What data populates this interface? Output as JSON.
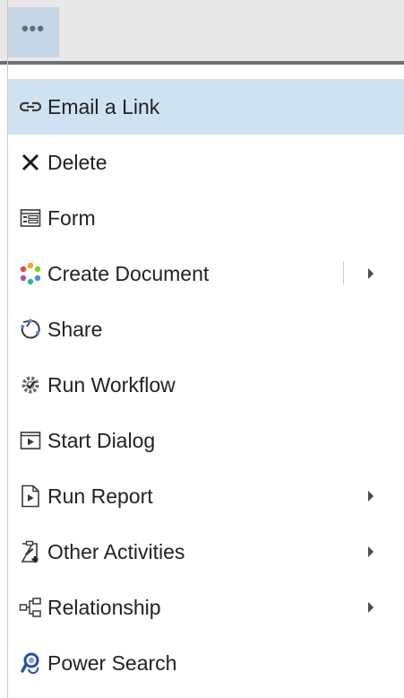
{
  "toolbar": {
    "more_label": "•••"
  },
  "menu": {
    "items": [
      {
        "label": "Email a Link",
        "icon": "link-icon"
      },
      {
        "label": "Delete",
        "icon": "delete-x-icon"
      },
      {
        "label": "Form",
        "icon": "form-icon"
      },
      {
        "label": "Create Document",
        "icon": "create-document-icon",
        "has_submenu": true
      },
      {
        "label": "Share",
        "icon": "share-icon"
      },
      {
        "label": "Run Workflow",
        "icon": "workflow-icon"
      },
      {
        "label": "Start Dialog",
        "icon": "start-dialog-icon"
      },
      {
        "label": "Run Report",
        "icon": "report-icon",
        "has_submenu": true
      },
      {
        "label": "Other Activities",
        "icon": "activities-icon",
        "has_submenu": true
      },
      {
        "label": "Relationship",
        "icon": "relationship-icon",
        "has_submenu": true
      },
      {
        "label": "Power Search",
        "icon": "power-search-icon"
      }
    ],
    "hovered_item": "Email a Link"
  },
  "colors": {
    "hover_bg": "#cfe2f2",
    "more_button_bg": "#c5d6e6",
    "topbar_bg": "#e8e8e8"
  }
}
